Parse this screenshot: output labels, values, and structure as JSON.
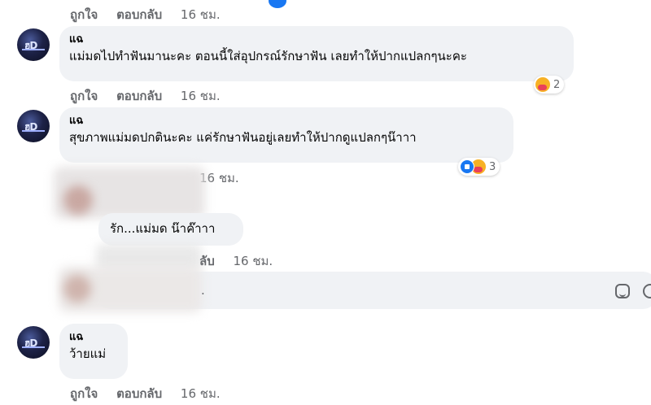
{
  "comments": [
    {
      "actions": {
        "like": "ถูกใจ",
        "reply": "ตอบกลับ",
        "time": "16 ชม."
      }
    },
    {
      "author": "แฉ",
      "text": "แม่มดไปทำฟันมานะคะ ตอนนี้ใส่อุปกรณ์รักษาฟัน เลยทำให้ปากแปลกๆนะคะ",
      "reactions": {
        "icons": [
          "care-emoji"
        ],
        "count": "2"
      },
      "actions": {
        "like": "ถูกใจ",
        "reply": "ตอบกลับ",
        "time": "16 ชม."
      }
    },
    {
      "author": "แฉ",
      "text": "สุขภาพแม่มดปกตินะคะ แค่รักษาฟันอยู่เลยทำให้ปากดูแปลกๆน๊าาา",
      "reactions": {
        "icons": [
          "like-emoji",
          "care-emoji"
        ],
        "count": "3"
      },
      "actions": {
        "time": "16 ชม."
      }
    },
    {
      "text": "รัก...แม่มด น๊าค๊าาา",
      "actions": {
        "reply": "ลับ",
        "time": "16 ชม."
      }
    },
    {
      "author": "แฉ",
      "text": "ว้ายแม่",
      "actions": {
        "like": "ถูกใจ",
        "reply": "ตอบกลับ",
        "time": "16 ชม."
      }
    }
  ],
  "reply_box": {
    "placeholder_fragment": ".",
    "icons": [
      "sticker-icon",
      "emoji-icon"
    ]
  },
  "colors": {
    "bubble": "#f0f2f5",
    "meta_text": "#65676b",
    "like_blue": "#1877f2",
    "care_yellow": "#f7b125"
  }
}
